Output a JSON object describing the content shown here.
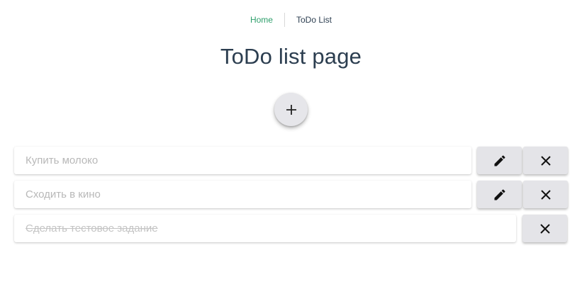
{
  "nav": {
    "home_label": "Home",
    "current_label": "ToDo List"
  },
  "page": {
    "title": "ToDo list page"
  },
  "add_button": {
    "icon": "plus-icon"
  },
  "todos": [
    {
      "text": "Купить молоко",
      "done": false,
      "edit_icon": "pencil-icon",
      "delete_icon": "close-icon"
    },
    {
      "text": "Сходить в кино",
      "done": false,
      "edit_icon": "pencil-icon",
      "delete_icon": "close-icon"
    },
    {
      "text": "Сделать тестовое задание",
      "done": true,
      "delete_icon": "close-icon"
    }
  ],
  "colors": {
    "link": "#2e9f6b",
    "text": "#2c3e50",
    "button_bg": "#e4e4e8",
    "placeholder": "#b8b8b8"
  }
}
